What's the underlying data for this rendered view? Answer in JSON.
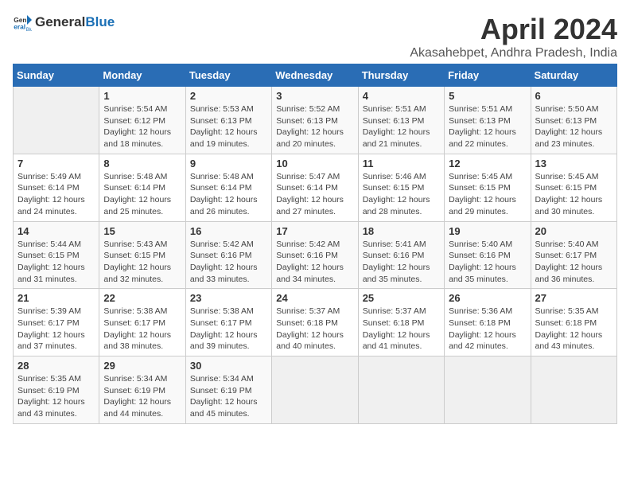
{
  "header": {
    "logo_general": "General",
    "logo_blue": "Blue",
    "title": "April 2024",
    "subtitle": "Akasahebpet, Andhra Pradesh, India"
  },
  "weekdays": [
    "Sunday",
    "Monday",
    "Tuesday",
    "Wednesday",
    "Thursday",
    "Friday",
    "Saturday"
  ],
  "weeks": [
    [
      {
        "day": "",
        "info": ""
      },
      {
        "day": "1",
        "info": "Sunrise: 5:54 AM\nSunset: 6:12 PM\nDaylight: 12 hours\nand 18 minutes."
      },
      {
        "day": "2",
        "info": "Sunrise: 5:53 AM\nSunset: 6:13 PM\nDaylight: 12 hours\nand 19 minutes."
      },
      {
        "day": "3",
        "info": "Sunrise: 5:52 AM\nSunset: 6:13 PM\nDaylight: 12 hours\nand 20 minutes."
      },
      {
        "day": "4",
        "info": "Sunrise: 5:51 AM\nSunset: 6:13 PM\nDaylight: 12 hours\nand 21 minutes."
      },
      {
        "day": "5",
        "info": "Sunrise: 5:51 AM\nSunset: 6:13 PM\nDaylight: 12 hours\nand 22 minutes."
      },
      {
        "day": "6",
        "info": "Sunrise: 5:50 AM\nSunset: 6:13 PM\nDaylight: 12 hours\nand 23 minutes."
      }
    ],
    [
      {
        "day": "7",
        "info": "Sunrise: 5:49 AM\nSunset: 6:14 PM\nDaylight: 12 hours\nand 24 minutes."
      },
      {
        "day": "8",
        "info": "Sunrise: 5:48 AM\nSunset: 6:14 PM\nDaylight: 12 hours\nand 25 minutes."
      },
      {
        "day": "9",
        "info": "Sunrise: 5:48 AM\nSunset: 6:14 PM\nDaylight: 12 hours\nand 26 minutes."
      },
      {
        "day": "10",
        "info": "Sunrise: 5:47 AM\nSunset: 6:14 PM\nDaylight: 12 hours\nand 27 minutes."
      },
      {
        "day": "11",
        "info": "Sunrise: 5:46 AM\nSunset: 6:15 PM\nDaylight: 12 hours\nand 28 minutes."
      },
      {
        "day": "12",
        "info": "Sunrise: 5:45 AM\nSunset: 6:15 PM\nDaylight: 12 hours\nand 29 minutes."
      },
      {
        "day": "13",
        "info": "Sunrise: 5:45 AM\nSunset: 6:15 PM\nDaylight: 12 hours\nand 30 minutes."
      }
    ],
    [
      {
        "day": "14",
        "info": "Sunrise: 5:44 AM\nSunset: 6:15 PM\nDaylight: 12 hours\nand 31 minutes."
      },
      {
        "day": "15",
        "info": "Sunrise: 5:43 AM\nSunset: 6:15 PM\nDaylight: 12 hours\nand 32 minutes."
      },
      {
        "day": "16",
        "info": "Sunrise: 5:42 AM\nSunset: 6:16 PM\nDaylight: 12 hours\nand 33 minutes."
      },
      {
        "day": "17",
        "info": "Sunrise: 5:42 AM\nSunset: 6:16 PM\nDaylight: 12 hours\nand 34 minutes."
      },
      {
        "day": "18",
        "info": "Sunrise: 5:41 AM\nSunset: 6:16 PM\nDaylight: 12 hours\nand 35 minutes."
      },
      {
        "day": "19",
        "info": "Sunrise: 5:40 AM\nSunset: 6:16 PM\nDaylight: 12 hours\nand 35 minutes."
      },
      {
        "day": "20",
        "info": "Sunrise: 5:40 AM\nSunset: 6:17 PM\nDaylight: 12 hours\nand 36 minutes."
      }
    ],
    [
      {
        "day": "21",
        "info": "Sunrise: 5:39 AM\nSunset: 6:17 PM\nDaylight: 12 hours\nand 37 minutes."
      },
      {
        "day": "22",
        "info": "Sunrise: 5:38 AM\nSunset: 6:17 PM\nDaylight: 12 hours\nand 38 minutes."
      },
      {
        "day": "23",
        "info": "Sunrise: 5:38 AM\nSunset: 6:17 PM\nDaylight: 12 hours\nand 39 minutes."
      },
      {
        "day": "24",
        "info": "Sunrise: 5:37 AM\nSunset: 6:18 PM\nDaylight: 12 hours\nand 40 minutes."
      },
      {
        "day": "25",
        "info": "Sunrise: 5:37 AM\nSunset: 6:18 PM\nDaylight: 12 hours\nand 41 minutes."
      },
      {
        "day": "26",
        "info": "Sunrise: 5:36 AM\nSunset: 6:18 PM\nDaylight: 12 hours\nand 42 minutes."
      },
      {
        "day": "27",
        "info": "Sunrise: 5:35 AM\nSunset: 6:18 PM\nDaylight: 12 hours\nand 43 minutes."
      }
    ],
    [
      {
        "day": "28",
        "info": "Sunrise: 5:35 AM\nSunset: 6:19 PM\nDaylight: 12 hours\nand 43 minutes."
      },
      {
        "day": "29",
        "info": "Sunrise: 5:34 AM\nSunset: 6:19 PM\nDaylight: 12 hours\nand 44 minutes."
      },
      {
        "day": "30",
        "info": "Sunrise: 5:34 AM\nSunset: 6:19 PM\nDaylight: 12 hours\nand 45 minutes."
      },
      {
        "day": "",
        "info": ""
      },
      {
        "day": "",
        "info": ""
      },
      {
        "day": "",
        "info": ""
      },
      {
        "day": "",
        "info": ""
      }
    ]
  ]
}
